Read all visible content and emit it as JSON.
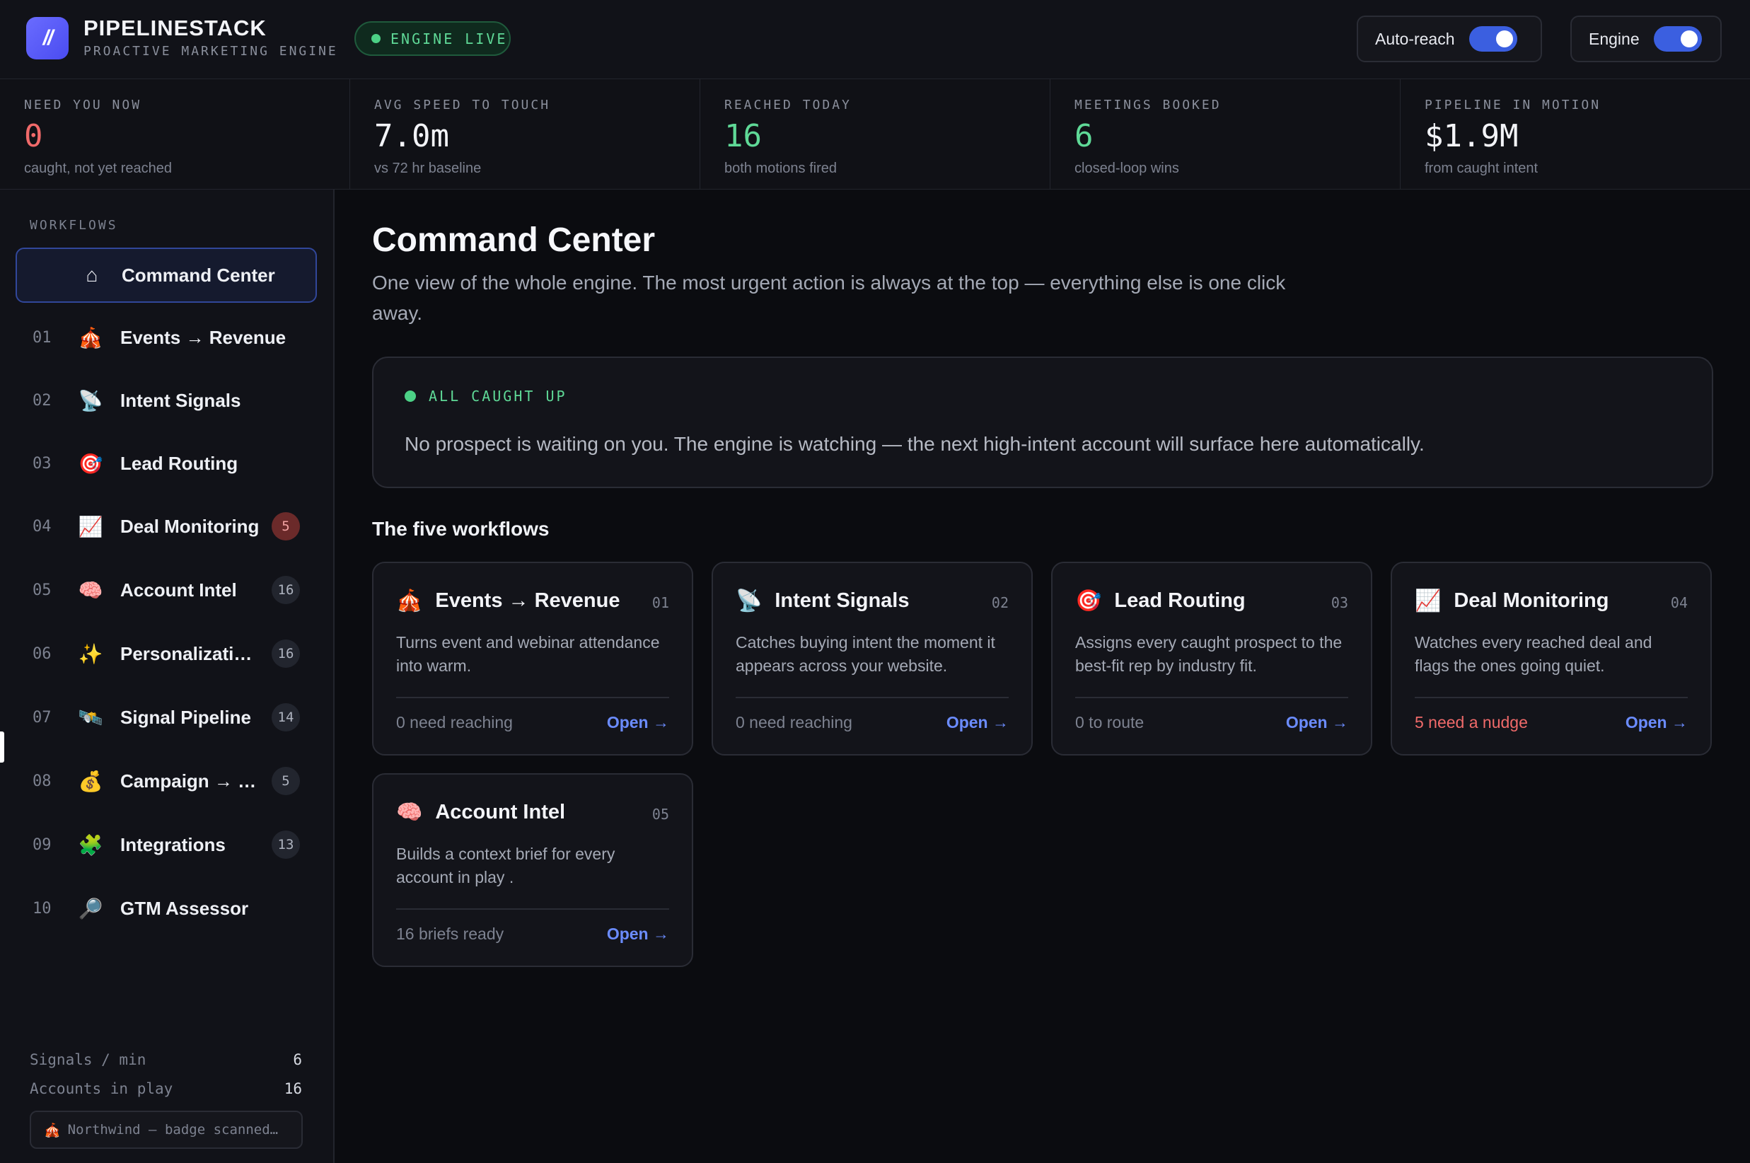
{
  "header": {
    "brand_name": "PIPELINESTACK",
    "brand_sub": "PROACTIVE MARKETING ENGINE",
    "logo_text": "//",
    "status_pill": "ENGINE LIVE",
    "toggles": [
      {
        "label": "Auto-reach",
        "on": true
      },
      {
        "label": "Engine",
        "on": true
      }
    ]
  },
  "metrics": [
    {
      "label": "NEED YOU NOW",
      "value": "0",
      "sub": "caught, not yet reached",
      "color": "#f06a6a"
    },
    {
      "label": "AVG SPEED TO TOUCH",
      "value": "7.0m",
      "sub": "vs 72 hr baseline",
      "color": "#f3f4f8"
    },
    {
      "label": "REACHED TODAY",
      "value": "16",
      "sub": "both motions fired",
      "color": "#5fd997"
    },
    {
      "label": "MEETINGS BOOKED",
      "value": "6",
      "sub": "closed-loop wins",
      "color": "#5fd997"
    },
    {
      "label": "PIPELINE IN MOTION",
      "value": "$1.9M",
      "sub": "from caught intent",
      "color": "#f3f4f8"
    }
  ],
  "sidebar": {
    "heading": "WORKFLOWS",
    "items": [
      {
        "num": "",
        "icon": "⌂",
        "icon_name": "home-icon",
        "label": "Command Center",
        "badge": "",
        "active": true
      },
      {
        "num": "01",
        "icon": "🎪",
        "icon_name": "circus-tent-icon",
        "label": "Events → Revenue",
        "badge": ""
      },
      {
        "num": "02",
        "icon": "📡",
        "icon_name": "satellite-dish-icon",
        "label": "Intent Signals",
        "badge": ""
      },
      {
        "num": "03",
        "icon": "🎯",
        "icon_name": "target-icon",
        "label": "Lead Routing",
        "badge": ""
      },
      {
        "num": "04",
        "icon": "📈",
        "icon_name": "chart-up-icon",
        "label": "Deal Monitoring",
        "badge": "5",
        "badge_alert": true
      },
      {
        "num": "05",
        "icon": "🧠",
        "icon_name": "brain-icon",
        "label": "Account Intel",
        "badge": "16"
      },
      {
        "num": "06",
        "icon": "✨",
        "icon_name": "sparkles-icon",
        "label": "Personalizati…",
        "badge": "16"
      },
      {
        "num": "07",
        "icon": "🛰️",
        "icon_name": "satellite-icon",
        "label": "Signal Pipeline",
        "badge": "14"
      },
      {
        "num": "08",
        "icon": "💰",
        "icon_name": "money-bag-icon",
        "label": "Campaign → …",
        "badge": "5"
      },
      {
        "num": "09",
        "icon": "🧩",
        "icon_name": "puzzle-icon",
        "label": "Integrations",
        "badge": "13"
      },
      {
        "num": "10",
        "icon": "🔎",
        "icon_name": "magnifier-icon",
        "label": "GTM Assessor",
        "badge": ""
      }
    ],
    "stats": [
      {
        "label": "Signals / min",
        "value": "6"
      },
      {
        "label": "Accounts in play",
        "value": "16"
      }
    ],
    "ticker": "Northwind — badge scanned…",
    "ticker_icon": "🎪"
  },
  "main": {
    "title": "Command Center",
    "description": "One view of the whole engine. The most urgent action is always at the top — everything else is one click away.",
    "caught": {
      "tag": "ALL CAUGHT UP",
      "message": "No prospect is waiting on you. The engine is watching — the next high-intent account will surface here automatically."
    },
    "section_title": "The five workflows",
    "workflows": [
      {
        "icon": "🎪",
        "icon_name": "circus-tent-icon",
        "title": "Events → Revenue",
        "num": "01",
        "desc": "Turns event and webinar attendance into warm.",
        "status": "0 need reaching",
        "open": "Open →"
      },
      {
        "icon": "📡",
        "icon_name": "satellite-dish-icon",
        "title": "Intent Signals",
        "num": "02",
        "desc": "Catches buying intent the moment it appears across your website.",
        "status": "0 need reaching",
        "open": "Open →"
      },
      {
        "icon": "🎯",
        "icon_name": "target-icon",
        "title": "Lead Routing",
        "num": "03",
        "desc": "Assigns every caught prospect to the best-fit rep by industry fit.",
        "status": "0 to route",
        "open": "Open →"
      },
      {
        "icon": "📈",
        "icon_name": "chart-up-icon",
        "title": "Deal Monitoring",
        "num": "04",
        "desc": "Watches every reached deal and flags the ones going quiet.",
        "status": "5 need a nudge",
        "status_alert": true,
        "open": "Open →"
      },
      {
        "icon": "🧠",
        "icon_name": "brain-icon",
        "title": "Account Intel",
        "num": "05",
        "desc": "Builds a context brief for every account in play .",
        "status": "16 briefs ready",
        "open": "Open →"
      }
    ]
  }
}
